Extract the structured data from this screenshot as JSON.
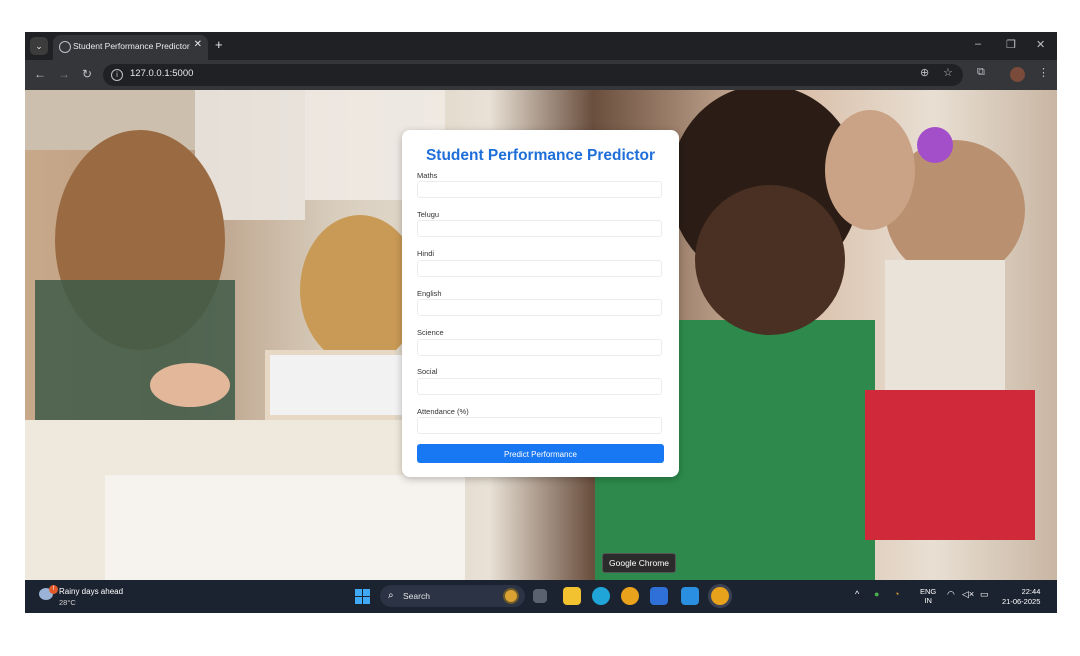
{
  "browser": {
    "tab_title": "Student Performance Predictor",
    "tab_close": "✕",
    "new_tab": "+",
    "url": "127.0.0.1:5000",
    "window_controls": [
      "–",
      "❐",
      "✕"
    ]
  },
  "form": {
    "title": "Student Performance Predictor",
    "fields": [
      {
        "label": "Maths",
        "value": ""
      },
      {
        "label": "Telugu",
        "value": ""
      },
      {
        "label": "Hindi",
        "value": ""
      },
      {
        "label": "English",
        "value": ""
      },
      {
        "label": "Science",
        "value": ""
      },
      {
        "label": "Social",
        "value": ""
      },
      {
        "label": "Attendance (%)",
        "value": ""
      }
    ],
    "submit_label": "Predict Performance"
  },
  "tooltip": "Google Chrome",
  "taskbar": {
    "weather_title": "Rainy days ahead",
    "weather_temp": "28°C",
    "search_label": "Search",
    "lang_top": "ENG",
    "lang_bottom": "IN",
    "time": "22:44",
    "date": "21-06-2025"
  },
  "colors": {
    "accent": "#1877f2",
    "title": "#1e6fd9",
    "browser_dark": "#202124",
    "taskbar": "#1c2330"
  }
}
